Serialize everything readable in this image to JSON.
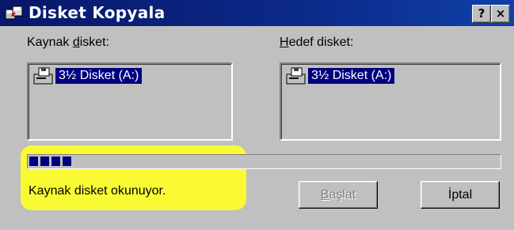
{
  "window": {
    "title": "Disket Kopyala",
    "help_button": "?",
    "close_button": "×"
  },
  "source": {
    "label_prefix": "Kaynak ",
    "label_accel": "d",
    "label_suffix": "isket:",
    "item": "3½ Disket (A:)"
  },
  "destination": {
    "label_accel": "H",
    "label_suffix": "edef disket:",
    "item": "3½ Disket (A:)"
  },
  "progress": {
    "segments_filled": 4,
    "fraction": 0.07
  },
  "status_text": "Kaynak disket okunuyor.",
  "buttons": {
    "start_accel": "B",
    "start_rest": "aşlat",
    "cancel": "İptal"
  },
  "colors": {
    "titlebar": "#0b1f6e",
    "selection": "#000080",
    "highlight": "#ffff28",
    "dialog": "#c0c0c0"
  }
}
